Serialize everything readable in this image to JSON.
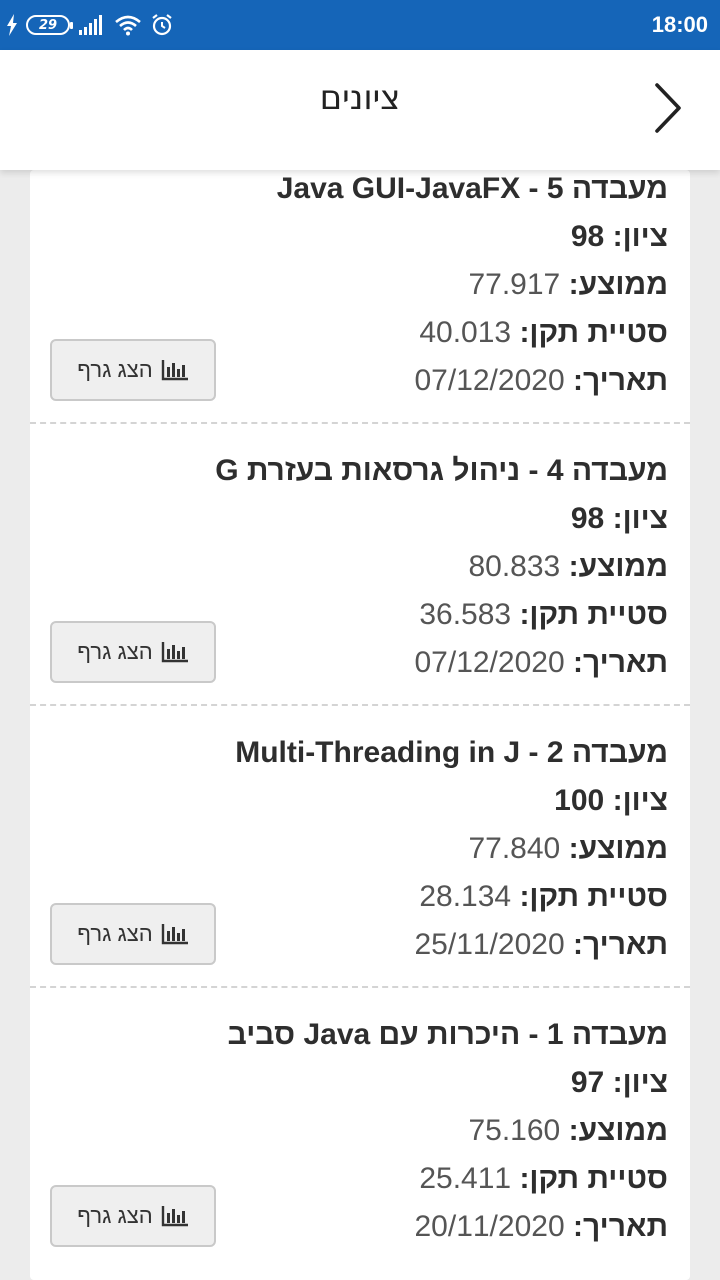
{
  "status_bar": {
    "battery_level": "29",
    "time": "18:00",
    "icons": [
      "charging-bolt-icon",
      "battery-icon",
      "signal-icon",
      "wifi-icon",
      "alarm-icon"
    ]
  },
  "header": {
    "title": "ציונים",
    "back_icon": "chevron-right-icon"
  },
  "labels": {
    "grade": "ציון:",
    "average": "ממוצע:",
    "std_dev": "סטיית תקן:",
    "date": "תאריך:",
    "show_graph": "הצג גרף"
  },
  "entries": [
    {
      "title": "מעבדה 5 - Java GUI-JavaFX",
      "grade": "98",
      "average": "77.917",
      "std_dev": "40.013",
      "date": "07/12/2020"
    },
    {
      "title": "מעבדה 4 - ניהול גרסאות בעזרת G",
      "grade": "98",
      "average": "80.833",
      "std_dev": "36.583",
      "date": "07/12/2020"
    },
    {
      "title": "מעבדה 2 - Multi-Threading in J",
      "grade": "100",
      "average": "77.840",
      "std_dev": "28.134",
      "date": "25/11/2020"
    },
    {
      "title": "מעבדה 1 - היכרות עם Java סביב",
      "grade": "97",
      "average": "75.160",
      "std_dev": "25.411",
      "date": "20/11/2020"
    }
  ],
  "colors": {
    "status_bar": "#1565b8",
    "background": "#ececec",
    "card": "#ffffff",
    "button_bg": "#efefef"
  }
}
